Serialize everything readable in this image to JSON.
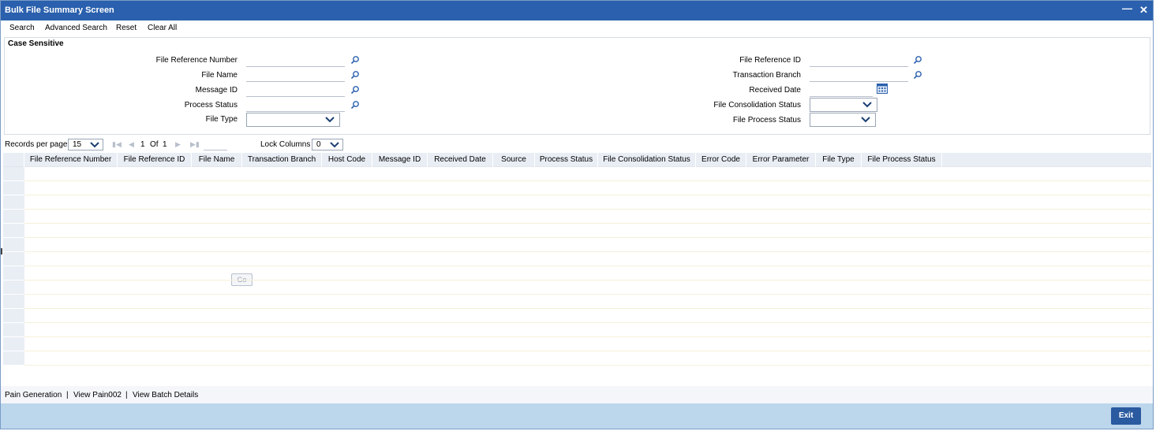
{
  "window": {
    "title": "Bulk File Summary Screen",
    "minimize_glyph": "—",
    "close_glyph": "✕"
  },
  "toolbar": {
    "search": "Search",
    "advanced_search": "Advanced Search",
    "reset": "Reset",
    "clear_all": "Clear All"
  },
  "criteria": {
    "legend": "Case Sensitive",
    "file_reference_number": {
      "label": "File Reference Number",
      "value": ""
    },
    "file_name": {
      "label": "File Name",
      "value": ""
    },
    "message_id": {
      "label": "Message ID",
      "value": ""
    },
    "process_status": {
      "label": "Process Status",
      "value": ""
    },
    "file_type": {
      "label": "File Type",
      "value": ""
    },
    "file_reference_id": {
      "label": "File Reference ID",
      "value": ""
    },
    "transaction_branch": {
      "label": "Transaction Branch",
      "value": ""
    },
    "received_date": {
      "label": "Received Date",
      "value": ""
    },
    "file_consolidation_status": {
      "label": "File Consolidation Status",
      "value": ""
    },
    "file_process_status": {
      "label": "File Process Status",
      "value": ""
    }
  },
  "pager": {
    "records_per_page_label": "Records per page",
    "records_per_page_value": "15",
    "current_page": "1",
    "of_label": "Of",
    "total_pages": "1",
    "go_label": "Go",
    "lock_columns_label": "Lock Columns",
    "lock_columns_value": "0"
  },
  "grid": {
    "columns": [
      "File Reference Number",
      "File Reference ID",
      "File Name",
      "Transaction Branch",
      "Host Code",
      "Message ID",
      "Received Date",
      "Source",
      "Process Status",
      "File Consolidation Status",
      "Error Code",
      "Error Parameter",
      "File Type",
      "File Process Status"
    ],
    "rows": []
  },
  "footer_links": {
    "pain_generation": "Pain Generation",
    "view_pain002": "View Pain002",
    "view_batch_details": "View Batch Details",
    "separator": "|"
  },
  "actions": {
    "exit": "Exit"
  },
  "colors": {
    "titlebar": "#2a60ad",
    "bottom_bar": "#bcd6ec",
    "exit_button": "#2a5aa0",
    "grid_header": "#e9eef5"
  }
}
